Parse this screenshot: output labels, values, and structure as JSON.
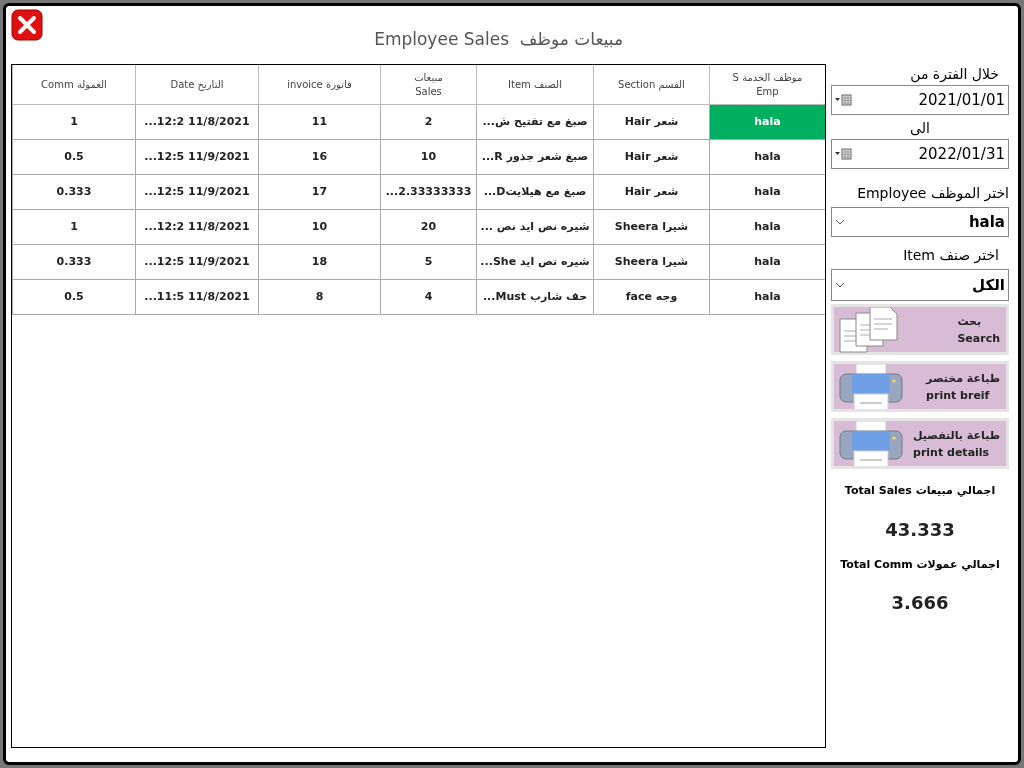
{
  "window": {
    "title": "مبيعات موظف  Employee Sales"
  },
  "table": {
    "columns": [
      {
        "label": "موظف الخدمة S",
        "label_2": "Emp"
      },
      {
        "label": "القسم Section"
      },
      {
        "label": "الصنف Item"
      },
      {
        "label": "مبيعات",
        "label_2": "Sales"
      },
      {
        "label": "فاتورة invoice"
      },
      {
        "label": "التاريخ Date"
      },
      {
        "label": "العمولة Comm"
      }
    ],
    "rows": [
      {
        "selected": true,
        "cells": [
          "hala",
          "شعر Hair",
          "صبغ مع تفتيح ش...",
          "2",
          "11",
          "...12:2 11/8/2021",
          "1"
        ]
      },
      {
        "selected": false,
        "cells": [
          "hala",
          "شعر Hair",
          "صبغ شعر جذور R...",
          "10",
          "16",
          "...12:5 11/9/2021",
          "0.5"
        ]
      },
      {
        "selected": false,
        "cells": [
          "hala",
          "شعر Hair",
          "صبغ مع هيلايتD...",
          "...2.33333333",
          "17",
          "...12:5 11/9/2021",
          "0.333"
        ]
      },
      {
        "selected": false,
        "cells": [
          "hala",
          "شيرا Sheera",
          "شيره نص ايد نص ...",
          "20",
          "10",
          "...12:2 11/8/2021",
          "1"
        ]
      },
      {
        "selected": false,
        "cells": [
          "hala",
          "شيرا Sheera",
          "شيره نص ايد She...",
          "5",
          "18",
          "...12:5 11/9/2021",
          "0.333"
        ]
      },
      {
        "selected": false,
        "cells": [
          "hala",
          "وجه face",
          "حف شارب Must...",
          "4",
          "8",
          "...11:5 11/8/2021",
          "0.5"
        ]
      }
    ]
  },
  "filters": {
    "from_label": "خلال الفترة من",
    "from_date": "2021/01/01",
    "to_label": "الى",
    "to_date": "2022/01/31",
    "employee_label": "اختر الموظف Employee",
    "employee_value": "hala",
    "item_label": "اختر صنف Item",
    "item_value": "الكل"
  },
  "buttons": [
    {
      "kind": "search",
      "label": "بحث",
      "label_2": "Search"
    },
    {
      "kind": "print",
      "label": "طباعة مختصر",
      "label_2": "print breif"
    },
    {
      "kind": "print",
      "label": "طباعة بالتفصيل",
      "label_2": "print details"
    }
  ],
  "totals": [
    {
      "label": "اجمالي مبيعات Total Sales",
      "value": "43.333"
    },
    {
      "label": "اجمالي عمولات Total Comm",
      "value": "3.666"
    }
  ]
}
